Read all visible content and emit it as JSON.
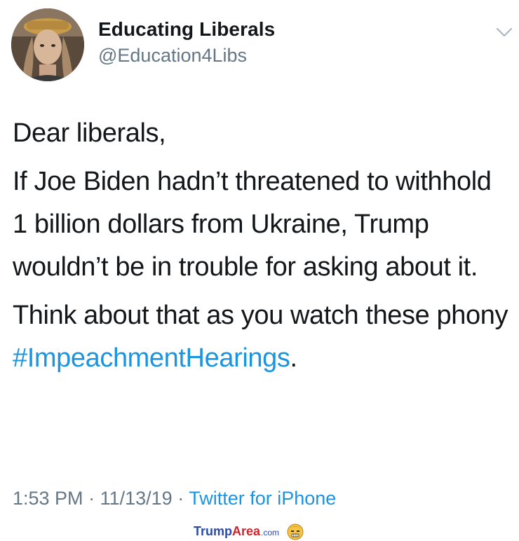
{
  "tweet": {
    "display_name": "Educating Liberals",
    "handle": "@Education4Libs",
    "greeting": "Dear liberals,",
    "paragraph_1": "If Joe Biden hadn’t threatened to withhold 1 billion dollars from Ukraine, Trump wouldn’t be in trouble for asking about it.",
    "paragraph_2_prefix": "Think about that as you watch these phony ",
    "hashtag": "#ImpeachmentHearings",
    "paragraph_2_suffix": ".",
    "time": "1:53 PM",
    "separator": "·",
    "date": "11/13/19",
    "source": "Twitter for iPhone"
  },
  "icons": {
    "avatar": "profile-photo",
    "menu": "chevron-down-icon"
  },
  "watermark": {
    "brand_part_1": "Trump",
    "brand_part_2": "Area",
    "brand_suffix": ".com",
    "logo": "trump-face-emoji-logo"
  },
  "colors": {
    "text": "#14171a",
    "secondary": "#657786",
    "link": "#1b95e0"
  }
}
